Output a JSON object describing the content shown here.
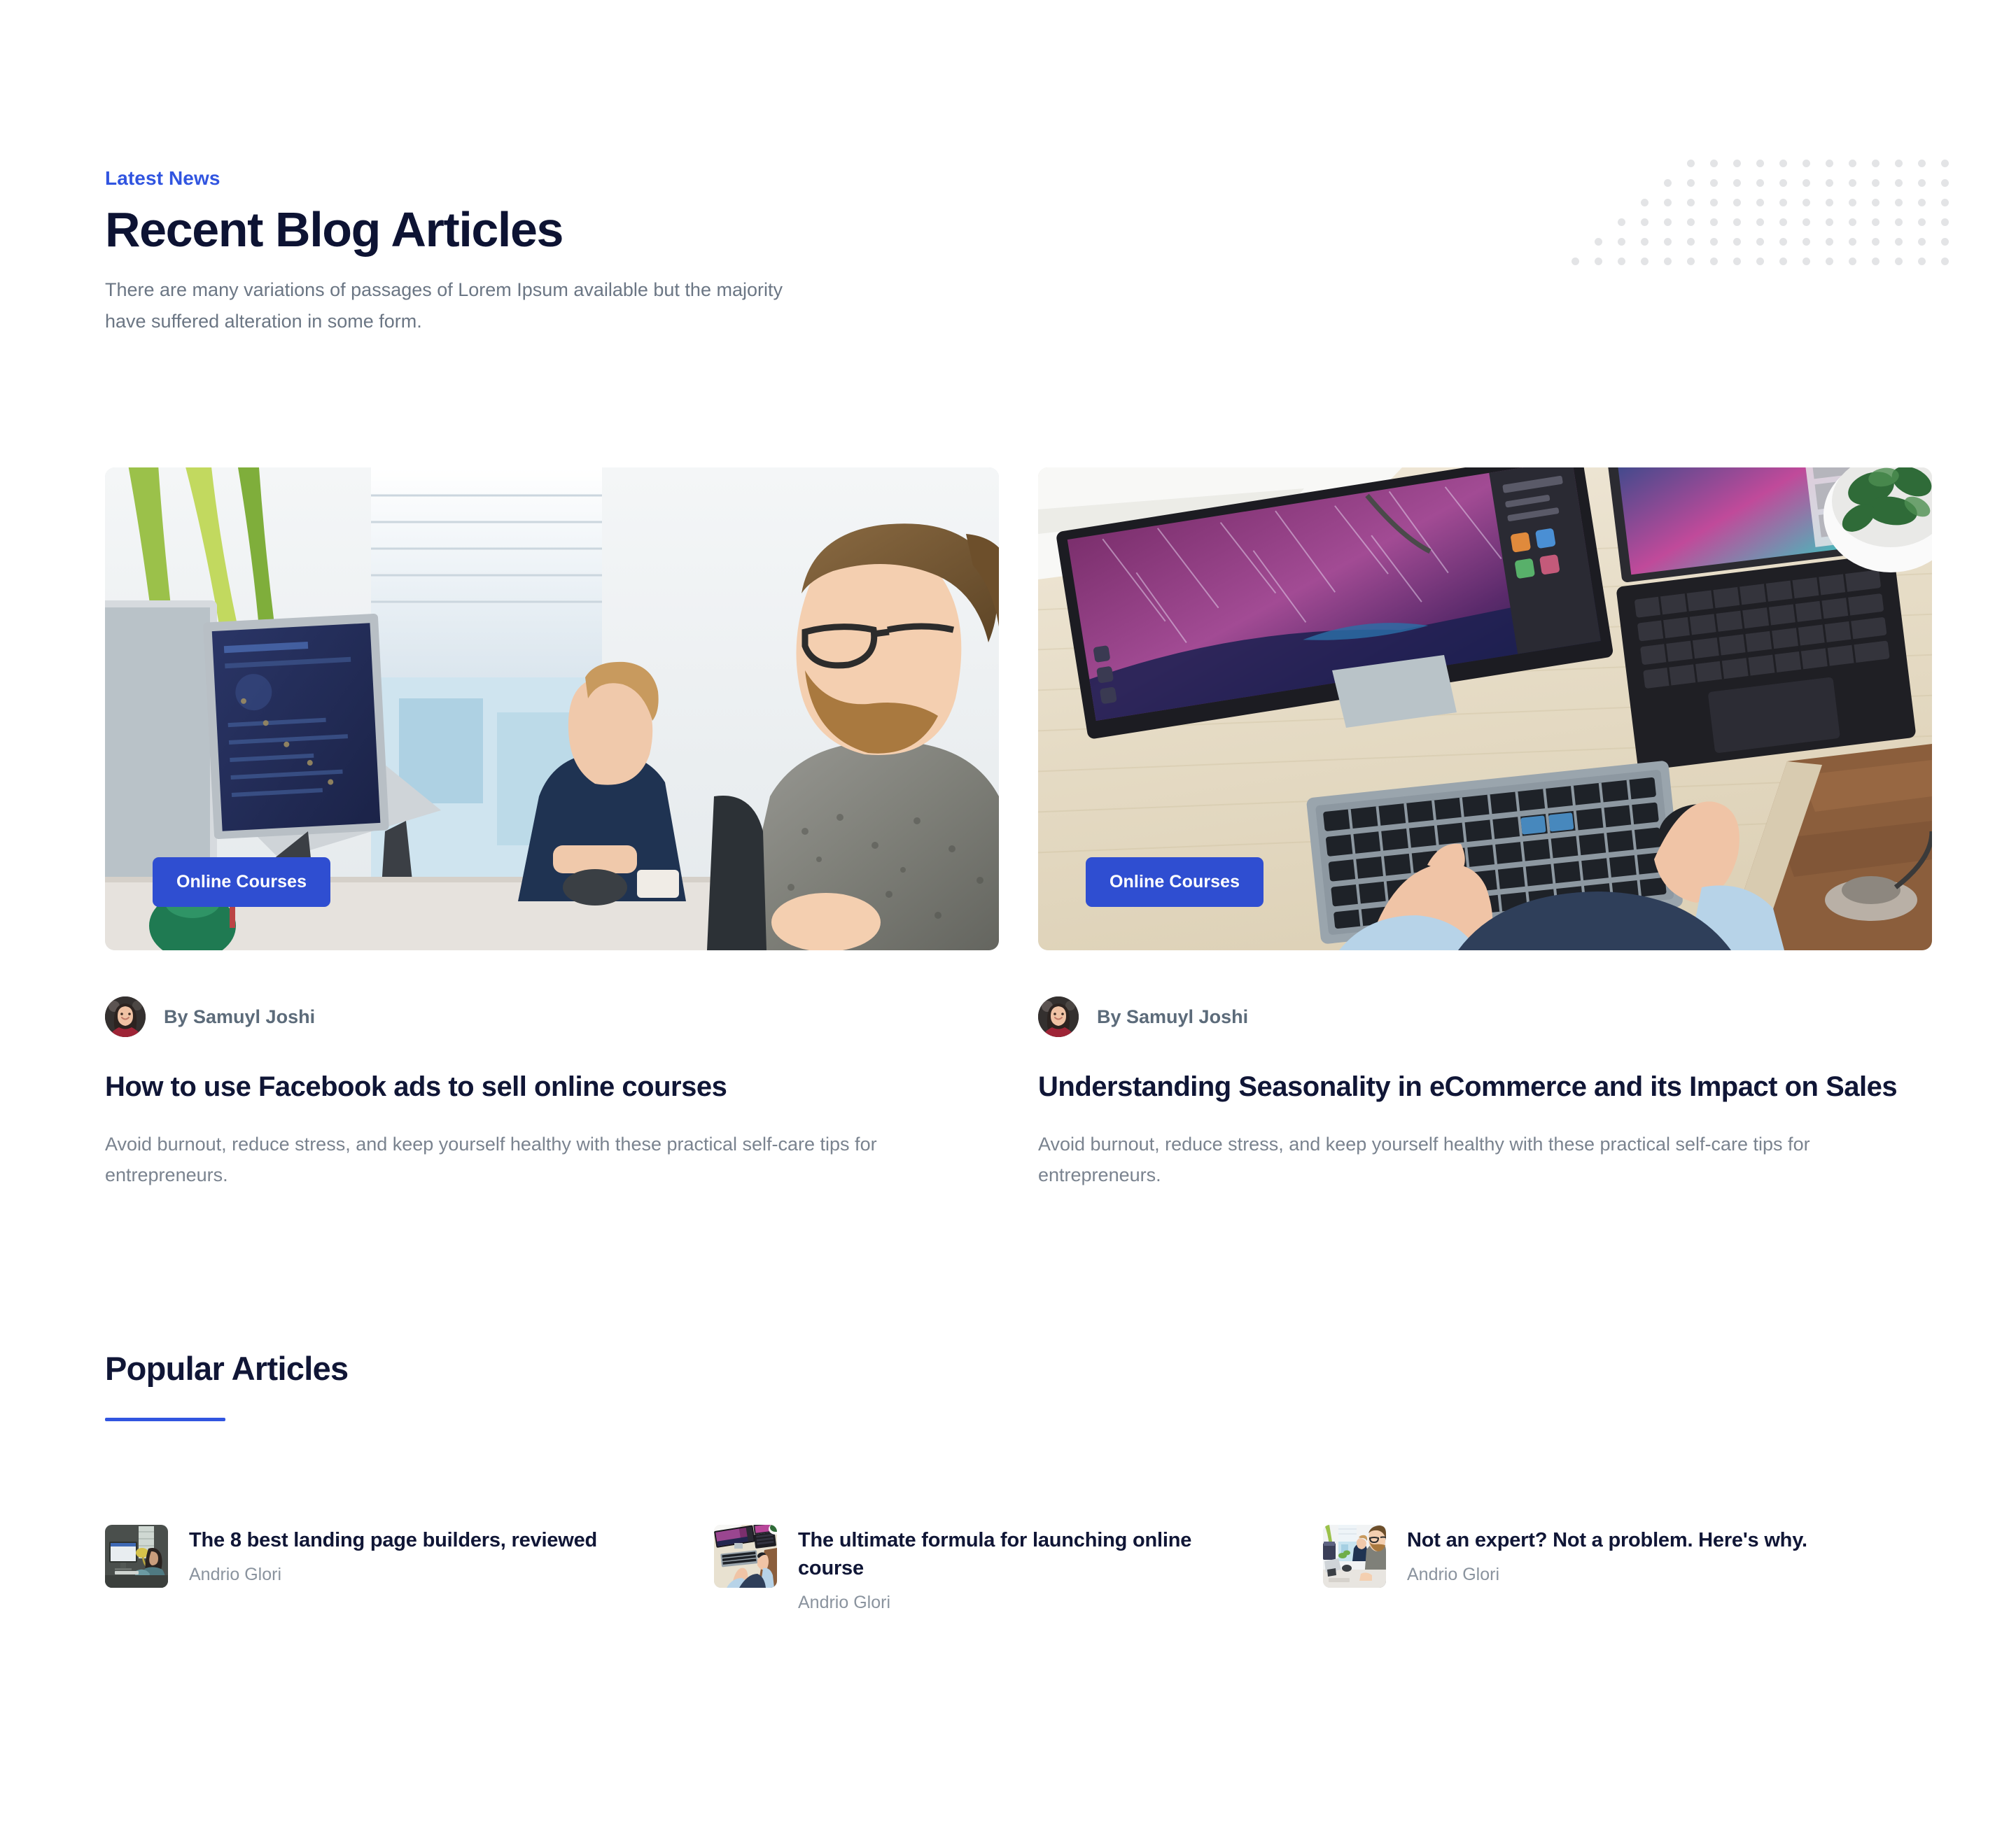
{
  "header": {
    "eyebrow": "Latest News",
    "title": "Recent Blog Articles",
    "subtitle": "There are many variations of passages of Lorem Ipsum available but the majority have suffered alteration in some form."
  },
  "colors": {
    "accent_blue": "#3155e0",
    "badge_blue": "#2f4ed1",
    "heading_navy": "#101636",
    "body_gray": "#7a838f",
    "dot_gray": "#e3e4e6",
    "background": "#ffffff"
  },
  "decoration": {
    "dot_grid": {
      "rows": 6,
      "columns_per_row": [
        12,
        13,
        14,
        15,
        16,
        17
      ]
    }
  },
  "articles": [
    {
      "badge": "Online Courses",
      "author": "By Samuyl Joshi",
      "title": "How to use Facebook ads to sell online courses",
      "excerpt": "Avoid burnout, reduce stress, and keep yourself healthy with these practical self-care tips for entrepreneurs.",
      "image_alt": "two-men-working-at-desktop-computers-in-bright-office"
    },
    {
      "badge": "Online Courses",
      "author": "By Samuyl Joshi",
      "title": "Understanding Seasonality in eCommerce and its Impact on Sales",
      "excerpt": "Avoid burnout, reduce stress, and keep yourself healthy with these practical self-care tips for entrepreneurs.",
      "image_alt": "overhead-view-of-desk-with-purple-monitor-keyboard-and-laptop"
    }
  ],
  "popular": {
    "heading": "Popular Articles",
    "items": [
      {
        "title": "The 8 best landing page builders, reviewed",
        "author": "Andrio Glori",
        "image_alt": "person-at-desk-with-imac-by-window"
      },
      {
        "title": "The ultimate formula for launching online course",
        "author": "Andrio Glori",
        "image_alt": "overhead-view-of-desk-with-purple-monitor-keyboard-and-laptop"
      },
      {
        "title": "Not an expert? Not a problem. Here's why.",
        "author": "Andrio Glori",
        "image_alt": "two-men-working-at-desktop-computers-in-bright-office"
      }
    ]
  }
}
